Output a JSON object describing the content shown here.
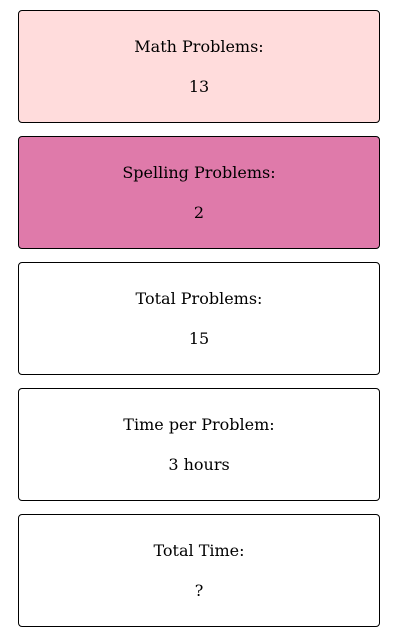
{
  "cards": [
    {
      "label": "Math Problems:",
      "value": "13",
      "color": "#ffdcdc"
    },
    {
      "label": "Spelling Problems:",
      "value": "2",
      "color": "#df7aaa"
    },
    {
      "label": "Total Problems:",
      "value": "15",
      "color": "#ffffff"
    },
    {
      "label": "Time per Problem:",
      "value": "3 hours",
      "color": "#ffffff"
    },
    {
      "label": "Total Time:",
      "value": "?",
      "color": "#ffffff"
    }
  ]
}
